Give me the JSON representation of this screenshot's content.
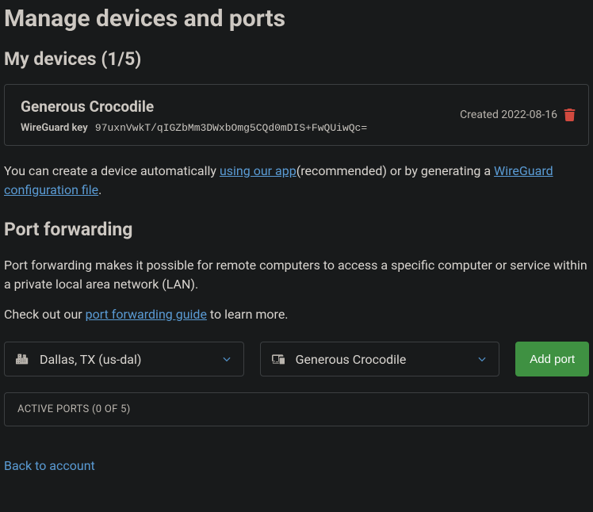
{
  "page_title": "Manage devices and ports",
  "devices": {
    "heading": "My devices (1/5)",
    "items": [
      {
        "name": "Generous Crocodile",
        "wg_label": "WireGuard key",
        "wg_key": "97uxnVwkT/qIGZbMm3DWxbOmg5CQd0mDIS+FwQUiwQc=",
        "created_label": "Created 2022-08-16"
      }
    ]
  },
  "create_text": {
    "pre": "You can create a device automatically ",
    "app_link": "using our app",
    "mid": "(recommended) or by generating a ",
    "wg_link": "WireGuard configuration file",
    "post": "."
  },
  "port_forwarding": {
    "heading": "Port forwarding",
    "desc": "Port forwarding makes it possible for remote computers to access a specific computer or service within a private local area network (LAN).",
    "guide_pre": "Check out our ",
    "guide_link": "port forwarding guide",
    "guide_post": " to learn more.",
    "location_select": "Dallas, TX (us-dal)",
    "device_select": "Generous Crocodile",
    "add_port_label": "Add port",
    "active_ports_label": "ACTIVE PORTS (0 OF 5)"
  },
  "back_link": "Back to account"
}
